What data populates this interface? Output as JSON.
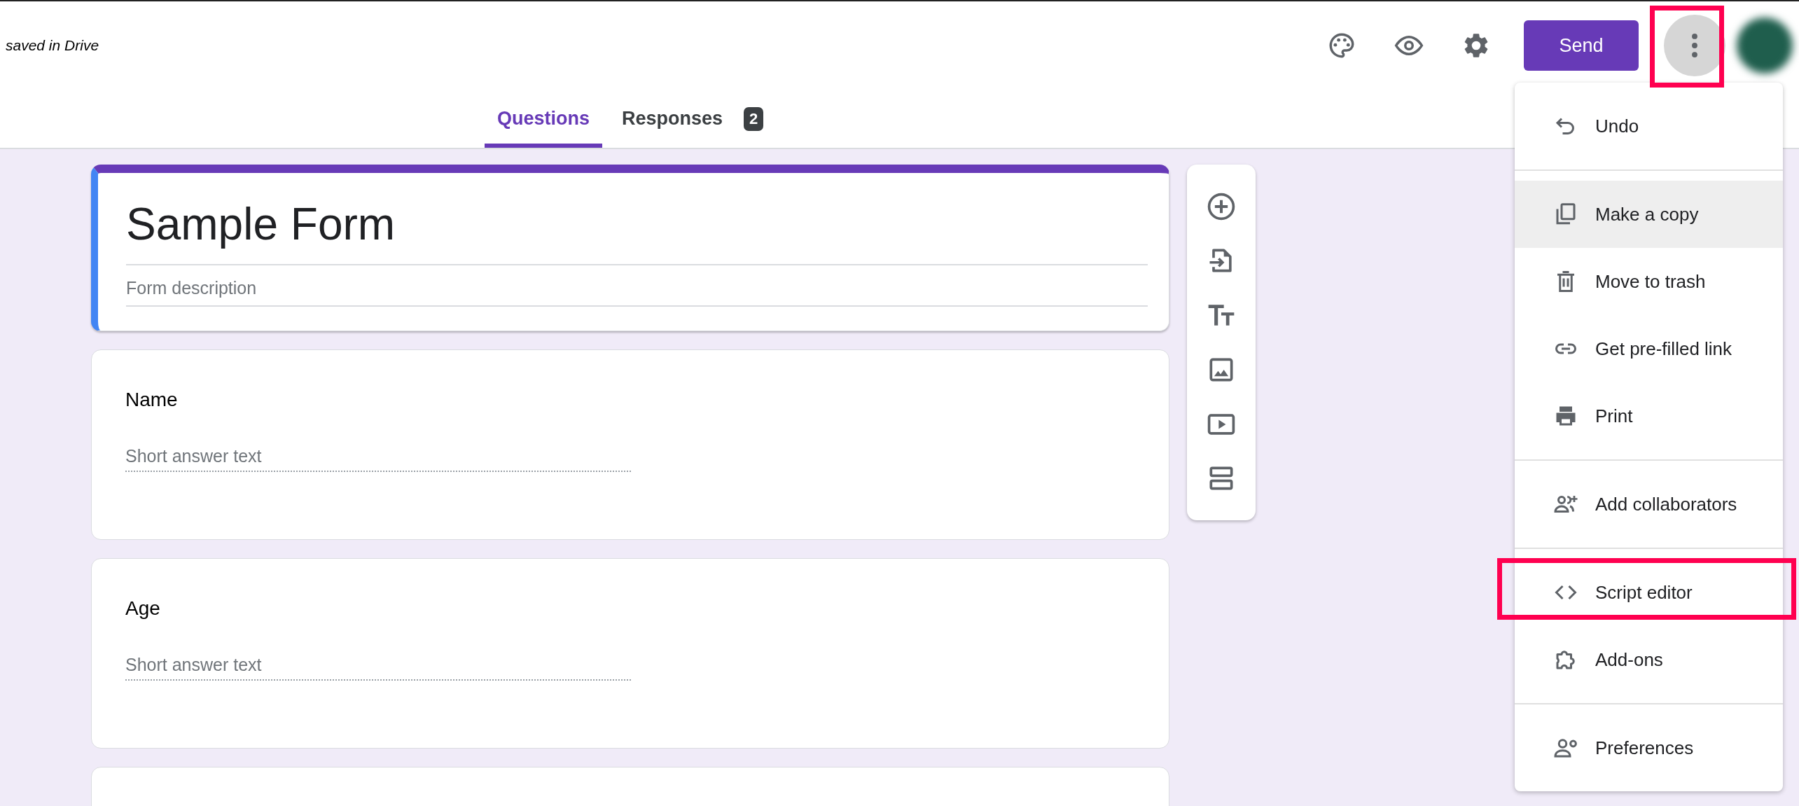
{
  "header": {
    "status": "saved in Drive",
    "send_button": "Send"
  },
  "tabs": [
    {
      "label": "Questions",
      "selected": true
    },
    {
      "label": "Responses",
      "selected": false,
      "badge": "2"
    }
  ],
  "form": {
    "title": "Sample Form",
    "description_placeholder": "Form description"
  },
  "questions": [
    {
      "title": "Name",
      "placeholder": "Short answer text"
    },
    {
      "title": "Age",
      "placeholder": "Short answer text"
    }
  ],
  "menu": {
    "groups": [
      [
        {
          "label": "Undo",
          "selected": false
        }
      ],
      [
        {
          "label": "Make a copy",
          "selected": true
        },
        {
          "label": "Move to trash",
          "selected": false
        },
        {
          "label": "Get pre-filled link",
          "selected": false
        },
        {
          "label": "Print",
          "selected": false
        }
      ],
      [
        {
          "label": "Add collaborators",
          "selected": false
        }
      ],
      [
        {
          "label": "Script editor",
          "selected": false
        },
        {
          "label": "Add-ons",
          "selected": false
        }
      ],
      [
        {
          "label": "Preferences",
          "selected": false
        }
      ]
    ]
  }
}
